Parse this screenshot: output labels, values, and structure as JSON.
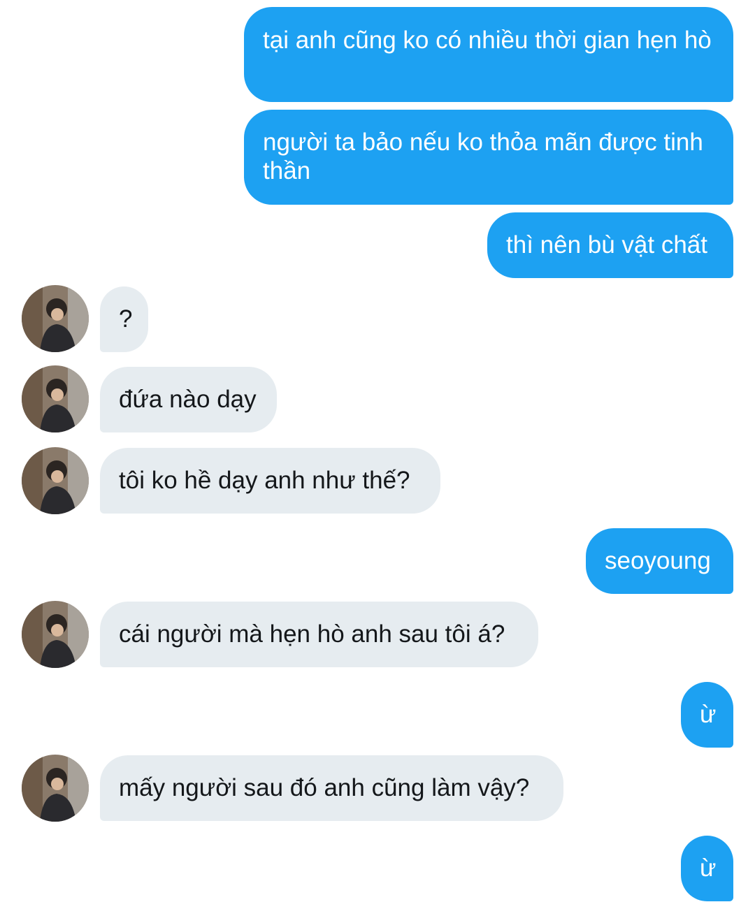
{
  "conversation": {
    "messages": [
      {
        "from": "me",
        "text": "tại anh cũng ko có nhiều thời gian hẹn hò"
      },
      {
        "from": "me",
        "text": "người ta bảo nếu ko thỏa mãn được tinh thần"
      },
      {
        "from": "me",
        "text": "thì nên bù vật chất"
      },
      {
        "from": "them",
        "text": "?"
      },
      {
        "from": "them",
        "text": "đứa nào dạy"
      },
      {
        "from": "them",
        "text": "tôi ko hề dạy anh như thế?"
      },
      {
        "from": "me",
        "text": "seoyoung"
      },
      {
        "from": "them",
        "text": "cái người mà hẹn hò anh sau tôi á?"
      },
      {
        "from": "me",
        "text": "ừ"
      },
      {
        "from": "them",
        "text": "mấy người sau đó anh cũng làm vậy?"
      },
      {
        "from": "me",
        "text": "ừ"
      }
    ]
  },
  "colors": {
    "sent_bubble": "#1da1f2",
    "received_bubble": "#e6ecf0",
    "sent_text": "#ffffff",
    "received_text": "#14171a"
  },
  "icons": {
    "avatar": "contact-avatar-photo"
  }
}
